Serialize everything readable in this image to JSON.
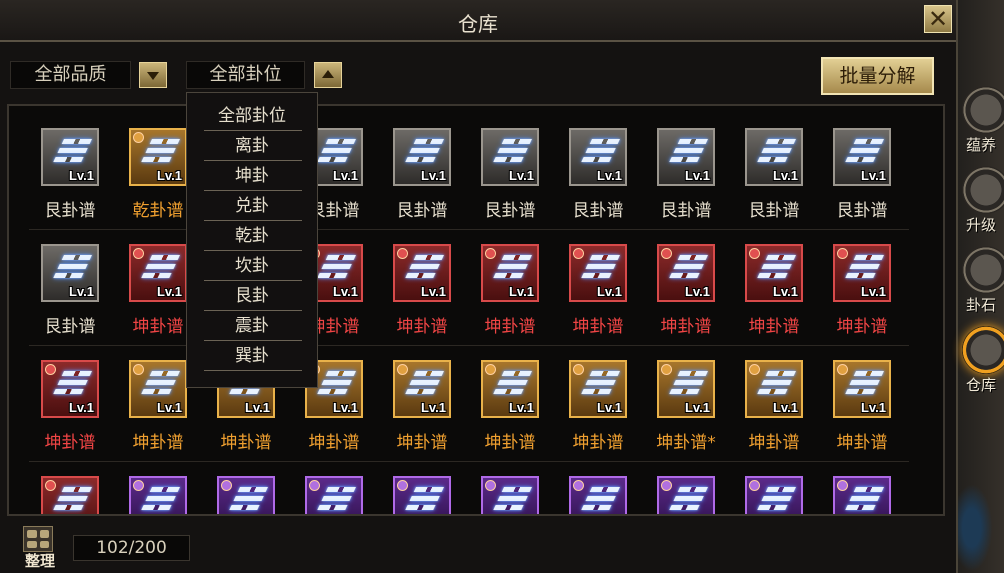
{
  "window": {
    "title": "仓库",
    "close_label": "✕"
  },
  "filters": {
    "quality_label": "全部品质",
    "position_label": "全部卦位",
    "batch_label": "批量分解"
  },
  "dropdown": {
    "options": [
      "全部卦位",
      "离卦",
      "坤卦",
      "兑卦",
      "乾卦",
      "坎卦",
      "艮卦",
      "震卦",
      "巽卦"
    ]
  },
  "inventory": {
    "rows": [
      [
        {
          "name": "艮卦谱",
          "level": "Lv.1",
          "quality": "grey"
        },
        {
          "name": "乾卦谱",
          "level": "Lv.1",
          "quality": "orange"
        },
        {
          "name": "",
          "level": "",
          "quality": "grey"
        },
        {
          "name": "艮卦谱",
          "level": "Lv.1",
          "quality": "grey"
        },
        {
          "name": "艮卦谱",
          "level": "Lv.1",
          "quality": "grey"
        },
        {
          "name": "艮卦谱",
          "level": "Lv.1",
          "quality": "grey"
        },
        {
          "name": "艮卦谱",
          "level": "Lv.1",
          "quality": "grey"
        },
        {
          "name": "艮卦谱",
          "level": "Lv.1",
          "quality": "grey"
        },
        {
          "name": "艮卦谱",
          "level": "Lv.1",
          "quality": "grey"
        },
        {
          "name": "艮卦谱",
          "level": "Lv.1",
          "quality": "grey"
        }
      ],
      [
        {
          "name": "艮卦谱",
          "level": "Lv.1",
          "quality": "grey"
        },
        {
          "name": "坤卦谱",
          "level": "Lv.1",
          "quality": "red"
        },
        {
          "name": "",
          "level": "",
          "quality": "red"
        },
        {
          "name": "坤卦谱",
          "level": "Lv.1",
          "quality": "red"
        },
        {
          "name": "坤卦谱",
          "level": "Lv.1",
          "quality": "red"
        },
        {
          "name": "坤卦谱",
          "level": "Lv.1",
          "quality": "red"
        },
        {
          "name": "坤卦谱",
          "level": "Lv.1",
          "quality": "red"
        },
        {
          "name": "坤卦谱",
          "level": "Lv.1",
          "quality": "red"
        },
        {
          "name": "坤卦谱",
          "level": "Lv.1",
          "quality": "red"
        },
        {
          "name": "坤卦谱",
          "level": "Lv.1",
          "quality": "red"
        }
      ],
      [
        {
          "name": "坤卦谱",
          "level": "Lv.1",
          "quality": "red"
        },
        {
          "name": "坤卦谱",
          "level": "Lv.1",
          "quality": "orange"
        },
        {
          "name": "坤卦谱",
          "level": "Lv.1",
          "quality": "orange"
        },
        {
          "name": "坤卦谱",
          "level": "Lv.1",
          "quality": "orange"
        },
        {
          "name": "坤卦谱",
          "level": "Lv.1",
          "quality": "orange"
        },
        {
          "name": "坤卦谱",
          "level": "Lv.1",
          "quality": "orange"
        },
        {
          "name": "坤卦谱",
          "level": "Lv.1",
          "quality": "orange"
        },
        {
          "name": "坤卦谱*",
          "level": "Lv.1",
          "quality": "orange"
        },
        {
          "name": "坤卦谱",
          "level": "Lv.1",
          "quality": "orange"
        },
        {
          "name": "坤卦谱",
          "level": "Lv.1",
          "quality": "orange"
        }
      ],
      [
        {
          "name": "",
          "level": "",
          "quality": "red"
        },
        {
          "name": "",
          "level": "",
          "quality": "purple"
        },
        {
          "name": "",
          "level": "",
          "quality": "purple"
        },
        {
          "name": "",
          "level": "",
          "quality": "purple"
        },
        {
          "name": "",
          "level": "",
          "quality": "purple"
        },
        {
          "name": "",
          "level": "",
          "quality": "purple"
        },
        {
          "name": "",
          "level": "",
          "quality": "purple"
        },
        {
          "name": "",
          "level": "",
          "quality": "purple"
        },
        {
          "name": "",
          "level": "",
          "quality": "purple"
        },
        {
          "name": "",
          "level": "",
          "quality": "purple"
        }
      ]
    ]
  },
  "footer": {
    "sort_label": "整理",
    "capacity": "102/200"
  },
  "side_menu": [
    {
      "label": "蕴养",
      "icon": "cultivate-icon",
      "active": false
    },
    {
      "label": "升级",
      "icon": "upgrade-icon",
      "active": false
    },
    {
      "label": "卦石",
      "icon": "stone-icon",
      "active": false
    },
    {
      "label": "仓库",
      "icon": "warehouse-icon",
      "active": true
    }
  ]
}
